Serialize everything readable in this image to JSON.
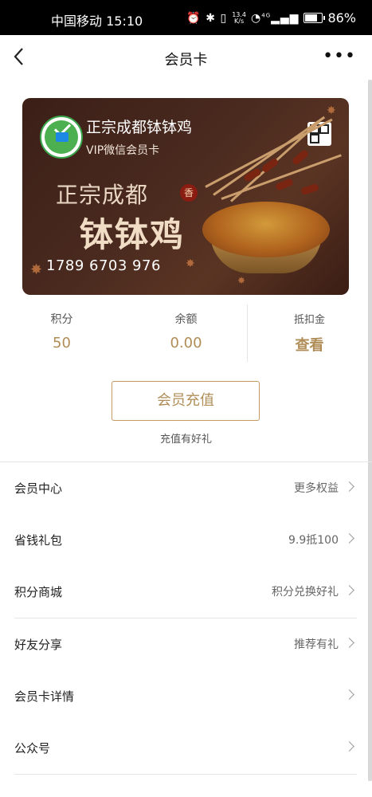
{
  "status_bar": {
    "carrier": "中国移动",
    "time": "15:10",
    "net_speed_value": "13.4",
    "net_speed_unit": "K/s",
    "network_badge": "4G",
    "battery_percent": "86%",
    "battery_level": 0.86
  },
  "nav": {
    "title": "会员卡"
  },
  "card": {
    "brand_name": "正宗成都钵钵鸡",
    "card_type": "VIP微信会员卡",
    "headline_line1": "正宗成都",
    "seal_char": "香",
    "headline_line2": "钵钵鸡",
    "card_number": "1789 6703 976",
    "colors": {
      "background": "#4a2a1f",
      "logo_green": "#4caf50"
    }
  },
  "stats": [
    {
      "label": "积分",
      "value": "50"
    },
    {
      "label": "余额",
      "value": "0.00"
    },
    {
      "label": "抵扣金",
      "value": "查看"
    }
  ],
  "recharge": {
    "button_label": "会员充值",
    "tip": "充值有好礼"
  },
  "menu": [
    {
      "label": "会员中心",
      "extra": "更多权益"
    },
    {
      "label": "省钱礼包",
      "extra": "9.9抵100"
    },
    {
      "label": "积分商城",
      "extra": "积分兑换好礼"
    },
    {
      "label": "好友分享",
      "extra": "推荐有礼"
    },
    {
      "label": "会员卡详情",
      "extra": ""
    },
    {
      "label": "公众号",
      "extra": ""
    }
  ],
  "theme": {
    "accent_gold": "#b08d57",
    "divider": "#e6e6e6"
  }
}
